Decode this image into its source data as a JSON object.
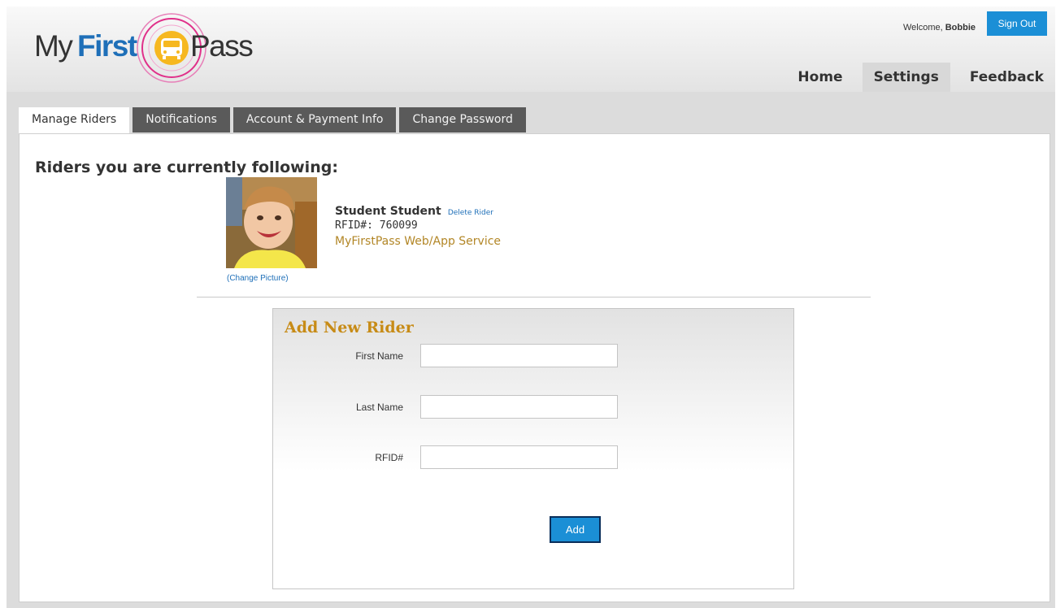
{
  "logo": {
    "my": "My",
    "first": "First",
    "pass": "Pass"
  },
  "header": {
    "welcome_prefix": "Welcome,",
    "user_name": "Bobbie",
    "sign_out_label": "Sign Out"
  },
  "nav": {
    "home": "Home",
    "settings": "Settings",
    "feedback": "Feedback",
    "active": "Settings"
  },
  "tabs": {
    "manage_riders": "Manage Riders",
    "notifications": "Notifications",
    "account_payment": "Account & Payment Info",
    "change_password": "Change Password",
    "active": "Manage Riders"
  },
  "riders": {
    "section_title": "Riders you are currently following:",
    "items": [
      {
        "name": "Student Student",
        "delete_label": "Delete Rider",
        "rfid_label": "RFID#: 760099",
        "service": "MyFirstPass Web/App Service",
        "change_picture_label": "(Change Picture)"
      }
    ]
  },
  "add_rider": {
    "title": "Add New Rider",
    "first_name_label": "First Name",
    "first_name_value": "",
    "last_name_label": "Last Name",
    "last_name_value": "",
    "rfid_label": "RFID#",
    "rfid_value": "",
    "add_button_label": "Add"
  },
  "colors": {
    "brand_blue": "#1b8fd6",
    "accent_gold": "#c78b16",
    "tab_dark": "#5a5a5a",
    "logo_pink": "#e0308a",
    "logo_yellow": "#f6b820"
  }
}
